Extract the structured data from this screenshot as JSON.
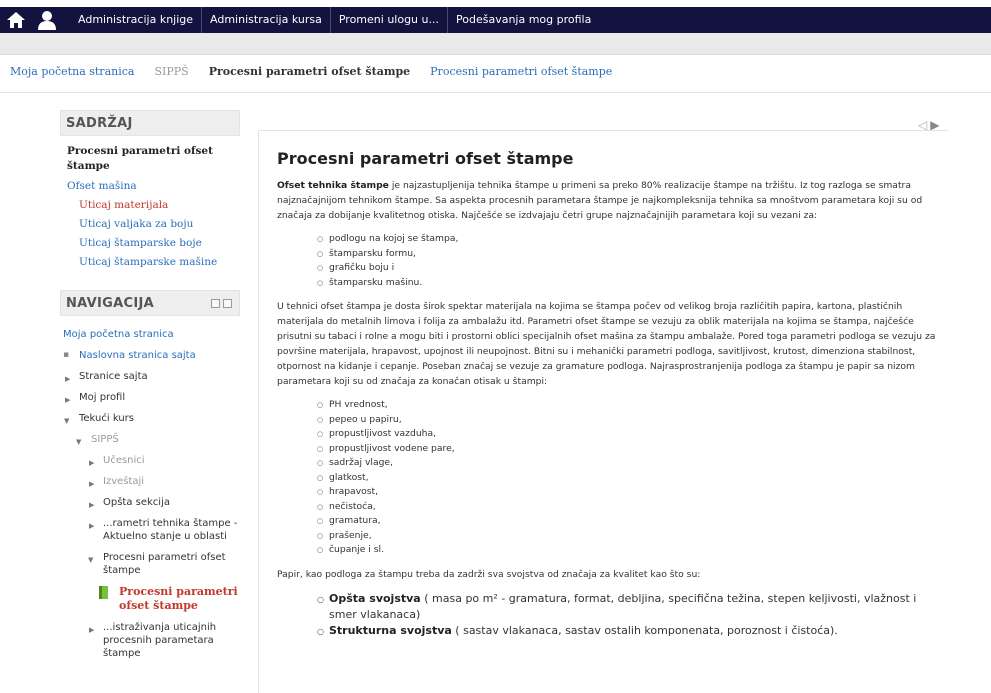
{
  "topbar": {
    "home_icon": "home-icon",
    "user_icon": "user-icon",
    "menu": [
      "Administracija knjige",
      "Administracija kursa",
      "Promeni ulogu u...",
      "Podešavanja mog profila"
    ]
  },
  "breadcrumb": [
    "Moja početna stranica",
    "SIPPŠ",
    "Procesni parametri ofset štampe",
    "Procesni parametri ofset štampe"
  ],
  "sidebar": {
    "toc_title": "SADRŽAJ",
    "toc_main": "Procesni parametri ofset štampe",
    "toc_items": [
      {
        "label": "Ofset mašina",
        "level": 1,
        "active": false
      },
      {
        "label": "Uticaj materijala",
        "level": 2,
        "active": true
      },
      {
        "label": "Uticaj valjaka za boju",
        "level": 2,
        "active": false
      },
      {
        "label": "Uticaj štamparske boje",
        "level": 2,
        "active": false
      },
      {
        "label": "Uticaj štamparske mašine",
        "level": 2,
        "active": false
      }
    ],
    "nav_title": "NAVIGACIJA",
    "nav": {
      "home": "Moja početna stranica",
      "site_home": "Naslovna stranica sajta",
      "site_pages": "Stranice sajta",
      "profile": "Moj profil",
      "current_course": "Tekući kurs",
      "course": "SIPPŠ",
      "participants": "Učesnici",
      "reports": "Izveštaji",
      "general": "Opšta sekcija",
      "section1": "...rametri tehnika štampe - Aktuelno stanje u oblasti",
      "section2": "Procesni parametri ofset štampe",
      "current": "Procesni parametri ofset štampe",
      "section3": "...istraživanja uticajnih procesnih parametara štampe"
    }
  },
  "content": {
    "title": "Procesni parametri ofset štampe",
    "p1_bold": "Ofset tehnika štampe",
    "p1": " je najzastupljenija tehnika štampe u primeni sa preko 80% realizacije štampe na tržištu. Iz tog razloga se smatra najznačajnijom tehnikom štampe. Sa aspekta procesnih parametara štampe je najkompleksnija tehnika sa mnoštvom parametara koji su od značaja za dobijanje kvalitetnog otiska. Najčešće se izdvajaju četri grupe najznačajnijih parametara koji su vezani za:",
    "list1": [
      "podlogu na kojoj se štampa,",
      "štamparsku formu,",
      "grafičku boju i",
      "štamparsku mašinu."
    ],
    "p2": "U tehnici ofset štampa je dosta širok spektar materijala na kojima se štampa počev od velikog broja različitih papira, kartona, plastičnih materijala do metalnih limova i folija za ambalažu itd. Parametri ofset štampe se vezuju za oblik materijala na kojima se štampa, najčešće prisutni su tabaci i rolne a mogu biti i prostorni oblici specijalnih ofset mašina za štampu ambalaže. Pored toga parametri podloga se vezuju za površine materijala, hrapavost, upojnost ili neupojnost. Bitni su i mehanički parametri podloga, savitljivost, krutost, dimenziona stabilnost, otpornost na kidanje i cepanje. Poseban značaj se vezuje za gramature podloga. Najrasprostranjenija podloga za štampu je papir sa nizom parametara koji su od značaja za konačan otisak u štampi:",
    "list2": [
      "PH vrednost,",
      "pepeo u papiru,",
      "propustljivost vazduha,",
      "propustljivost vodene pare,",
      "sadržaj vlage,",
      "glatkost,",
      "hrapavost,",
      "nečistoća,",
      "gramatura,",
      "prašenje,",
      "čupanje i sl."
    ],
    "p3": "Papir, kao podloga za štampu treba da zadrži sva svojstva od značaja za kvalitet kao što su:",
    "list3": [
      {
        "bold": "Opšta svojstva",
        "rest": " ( masa po m² - gramatura, format, debljina, specifična težina, stepen keljivosti, vlažnost i smer vlakanaca)"
      },
      {
        "bold": "Strukturna svojstva",
        "rest": " ( sastav vlakanaca, sastav ostalih komponenata, poroznost i čistoća)."
      }
    ]
  },
  "pager": {
    "prev_icon": "prev-arrow-icon",
    "next_icon": "next-arrow-icon"
  },
  "colors": {
    "topbar": "#14123f",
    "link": "#2a6ebb",
    "active": "#c0392b"
  }
}
